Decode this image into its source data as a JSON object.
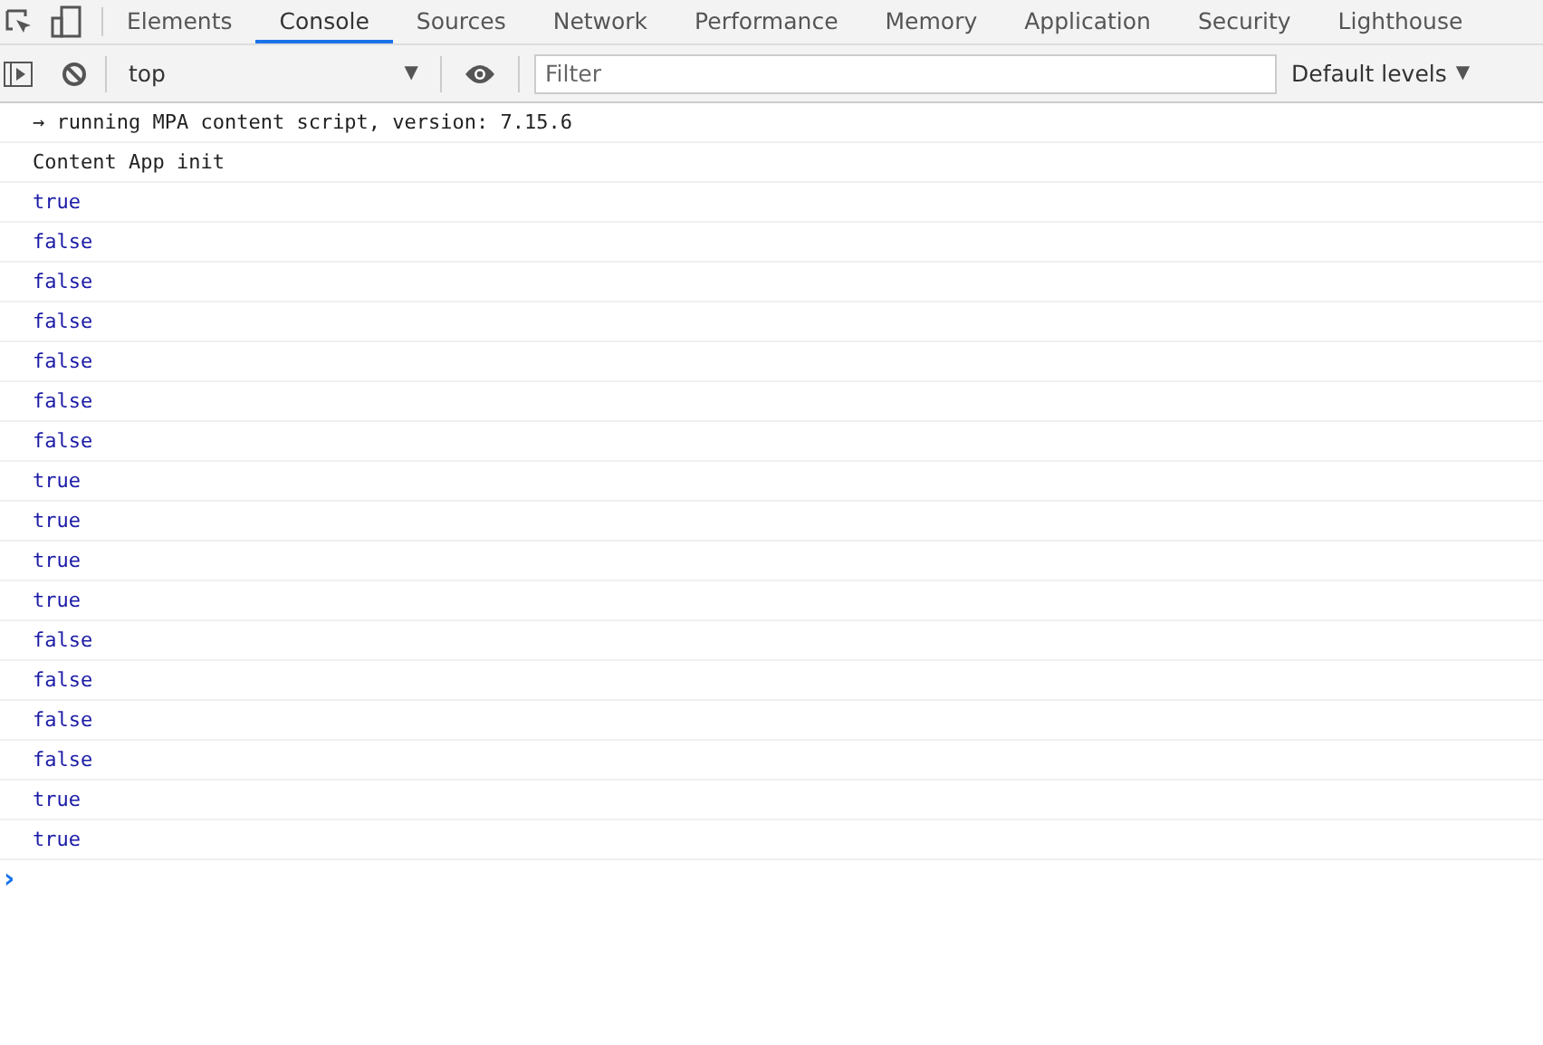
{
  "tabs": [
    {
      "label": "Elements",
      "selected": false
    },
    {
      "label": "Console",
      "selected": true
    },
    {
      "label": "Sources",
      "selected": false
    },
    {
      "label": "Network",
      "selected": false
    },
    {
      "label": "Performance",
      "selected": false
    },
    {
      "label": "Memory",
      "selected": false
    },
    {
      "label": "Application",
      "selected": false
    },
    {
      "label": "Security",
      "selected": false
    },
    {
      "label": "Lighthouse",
      "selected": false
    }
  ],
  "toolbar": {
    "context": "top",
    "filter": {
      "placeholder": "Filter"
    },
    "levels": "Default levels",
    "levels_caret": "▼",
    "context_caret": "▼"
  },
  "log": [
    {
      "kind": "text",
      "text": "→ running MPA content script, version: 7.15.6"
    },
    {
      "kind": "text",
      "text": "Content App init"
    },
    {
      "kind": "value",
      "text": "true"
    },
    {
      "kind": "value",
      "text": "false"
    },
    {
      "kind": "value",
      "text": "false"
    },
    {
      "kind": "value",
      "text": "false"
    },
    {
      "kind": "value",
      "text": "false"
    },
    {
      "kind": "value",
      "text": "false"
    },
    {
      "kind": "value",
      "text": "false"
    },
    {
      "kind": "value",
      "text": "true"
    },
    {
      "kind": "value",
      "text": "true"
    },
    {
      "kind": "value",
      "text": "true"
    },
    {
      "kind": "value",
      "text": "true"
    },
    {
      "kind": "value",
      "text": "false"
    },
    {
      "kind": "value",
      "text": "false"
    },
    {
      "kind": "value",
      "text": "false"
    },
    {
      "kind": "value",
      "text": "false"
    },
    {
      "kind": "value",
      "text": "true"
    },
    {
      "kind": "value",
      "text": "true"
    }
  ],
  "prompt": "›"
}
